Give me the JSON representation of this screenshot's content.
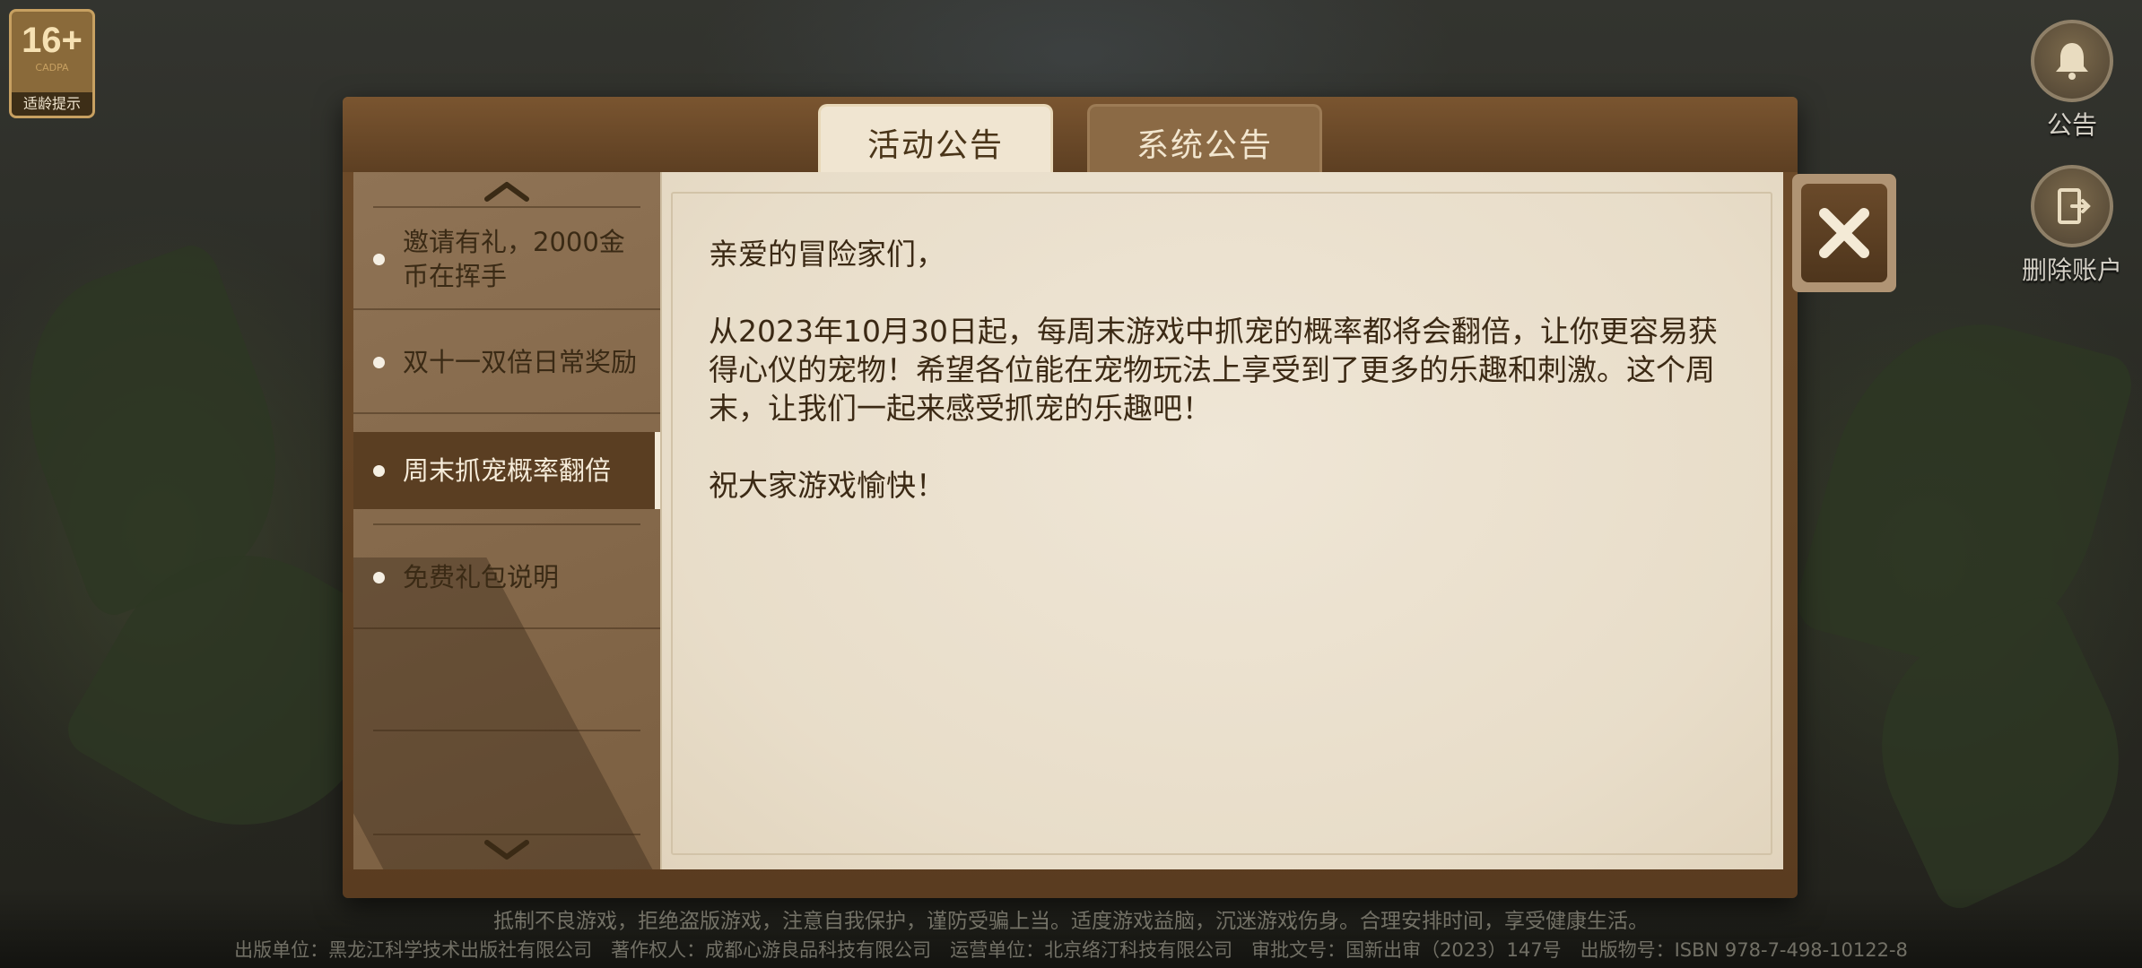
{
  "age_badge": {
    "rating": "16+",
    "small": "CADPA",
    "tip": "适龄提示"
  },
  "side": {
    "announcement_label": "公告",
    "delete_account_label": "删除账户"
  },
  "tabs": [
    {
      "label": "活动公告",
      "active": true
    },
    {
      "label": "系统公告",
      "active": false
    }
  ],
  "list": [
    {
      "label": "邀请有礼，2000金币在挥手",
      "selected": false
    },
    {
      "label": "双十一双倍日常奖励",
      "selected": false
    },
    {
      "label": "周末抓宠概率翻倍",
      "selected": true
    },
    {
      "label": "免费礼包说明",
      "selected": false
    }
  ],
  "content": {
    "greeting": "亲爱的冒险家们，",
    "body": "从2023年10月30日起，每周末游戏中抓宠的概率都将会翻倍，让你更容易获得心仪的宠物！希望各位能在宠物玩法上享受到了更多的乐趣和刺激。这个周末，让我们一起来感受抓宠的乐趣吧！",
    "closing": "祝大家游戏愉快！"
  },
  "footer": {
    "line1": "抵制不良游戏，拒绝盗版游戏，注意自我保护，谨防受骗上当。适度游戏益脑，沉迷游戏伤身。合理安排时间，享受健康生活。",
    "line2": "出版单位：黑龙江科学技术出版社有限公司　著作权人：成都心游良品科技有限公司　运营单位：北京络汀科技有限公司　审批文号：国新出审（2023）147号　出版物号：ISBN 978-7-498-10122-8"
  },
  "colors": {
    "accent": "#5a3e22",
    "paper": "#efe6d6",
    "text": "#3b2914"
  }
}
